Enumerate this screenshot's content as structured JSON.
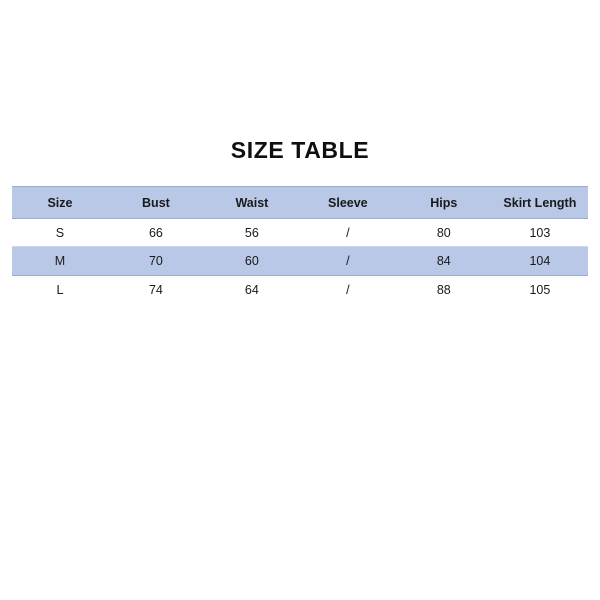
{
  "document": {
    "title": "SIZE TABLE",
    "background_color": "#ffffff"
  },
  "colors": {
    "header_band": "#b9c8e6",
    "zebra_band": "#b9c8e6",
    "row_plain": "#ffffff",
    "text": "#1a1a1a",
    "rule": "#cdd8ec"
  },
  "table": {
    "columns": [
      {
        "key": "size",
        "label": "Size"
      },
      {
        "key": "bust",
        "label": "Bust"
      },
      {
        "key": "waist",
        "label": "Waist"
      },
      {
        "key": "sleeve",
        "label": "Sleeve"
      },
      {
        "key": "hips",
        "label": "Hips"
      },
      {
        "key": "skirt",
        "label": "Skirt Length"
      }
    ],
    "rows": [
      {
        "size": "S",
        "bust": "66",
        "waist": "56",
        "sleeve": "/",
        "hips": "80",
        "skirt": "103"
      },
      {
        "size": "M",
        "bust": "70",
        "waist": "60",
        "sleeve": "/",
        "hips": "84",
        "skirt": "104"
      },
      {
        "size": "L",
        "bust": "74",
        "waist": "64",
        "sleeve": "/",
        "hips": "88",
        "skirt": "105"
      }
    ]
  }
}
